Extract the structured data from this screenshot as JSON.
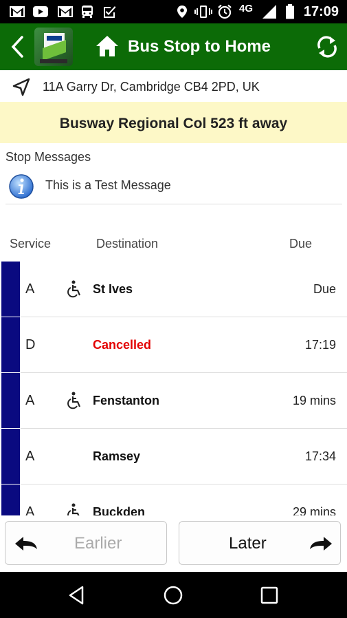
{
  "status_bar": {
    "time": "17:09",
    "network": "4G",
    "left_icons": [
      "gmail-icon",
      "youtube-icon",
      "gmail-icon",
      "bus-icon",
      "task-check-icon"
    ],
    "right_icons": [
      "location-pin-icon",
      "vibrate-icon",
      "alarm-icon",
      "signal-icon",
      "battery-icon"
    ]
  },
  "app_bar": {
    "title": "Bus Stop to Home",
    "background": "#0c6b07"
  },
  "location": {
    "address": "11A Garry Dr, Cambridge CB4 2PD, UK"
  },
  "stop_banner": {
    "text": "Busway Regional Col 523 ft away",
    "background": "#fdf8c7"
  },
  "messages": {
    "heading": "Stop Messages",
    "items": [
      "This is a Test Message"
    ]
  },
  "departures": {
    "headers": {
      "service": "Service",
      "destination": "Destination",
      "due": "Due"
    },
    "bar_color": "#0a0a80",
    "cancelled_color": "#e30000",
    "rows": [
      {
        "service": "A",
        "accessible": true,
        "destination": "St Ives",
        "due": "Due",
        "cancelled": false
      },
      {
        "service": "D",
        "accessible": false,
        "destination": "Cancelled",
        "due": "17:19",
        "cancelled": true
      },
      {
        "service": "A",
        "accessible": true,
        "destination": "Fenstanton",
        "due": "19 mins",
        "cancelled": false
      },
      {
        "service": "A",
        "accessible": false,
        "destination": "Ramsey",
        "due": "17:34",
        "cancelled": false
      },
      {
        "service": "A",
        "accessible": true,
        "destination": "Buckden",
        "due": "29 mins",
        "cancelled": false
      }
    ]
  },
  "navigation": {
    "earlier_label": "Earlier",
    "later_label": "Later"
  }
}
